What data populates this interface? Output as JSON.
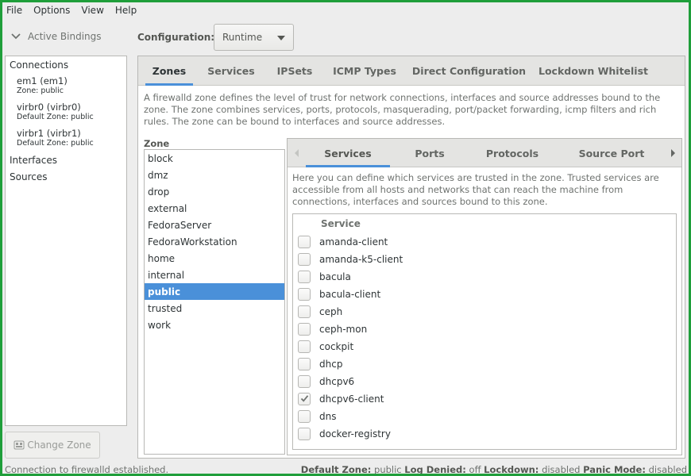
{
  "menubar": {
    "items": [
      "File",
      "Options",
      "View",
      "Help"
    ]
  },
  "sidebar": {
    "active_bindings_label": "Active Bindings",
    "connections_heading": "Connections",
    "connections": [
      {
        "name": "em1 (em1)",
        "zone": "Zone: public"
      },
      {
        "name": "virbr0 (virbr0)",
        "zone": "Default Zone: public"
      },
      {
        "name": "virbr1 (virbr1)",
        "zone": "Default Zone: public"
      }
    ],
    "interfaces_heading": "Interfaces",
    "sources_heading": "Sources",
    "change_zone_label": "Change Zone"
  },
  "configuration": {
    "label": "Configuration:",
    "value": "Runtime"
  },
  "main_tabs": [
    "Zones",
    "Services",
    "IPSets",
    "ICMP Types",
    "Direct Configuration",
    "Lockdown Whitelist"
  ],
  "active_main_tab": "Zones",
  "zone_description": "A firewalld zone defines the level of trust for network connections, interfaces and source addresses bound to the zone. The zone combines services, ports, protocols, masquerading, port/packet forwarding, icmp filters and rich rules. The zone can be bound to interfaces and source addresses.",
  "zone_label": "Zone",
  "zones": [
    "block",
    "dmz",
    "drop",
    "external",
    "FedoraServer",
    "FedoraWorkstation",
    "home",
    "internal",
    "public",
    "trusted",
    "work"
  ],
  "selected_zone": "public",
  "inner_tabs": [
    "Services",
    "Ports",
    "Protocols",
    "Source Port"
  ],
  "active_inner_tab": "Services",
  "services_description": "Here you can define which services are trusted in the zone. Trusted services are accessible from all hosts and networks that can reach the machine from connections, interfaces and sources bound to this zone.",
  "service_column_header": "Service",
  "services": [
    {
      "name": "amanda-client",
      "checked": false
    },
    {
      "name": "amanda-k5-client",
      "checked": false
    },
    {
      "name": "bacula",
      "checked": false
    },
    {
      "name": "bacula-client",
      "checked": false
    },
    {
      "name": "ceph",
      "checked": false
    },
    {
      "name": "ceph-mon",
      "checked": false
    },
    {
      "name": "cockpit",
      "checked": false
    },
    {
      "name": "dhcp",
      "checked": false
    },
    {
      "name": "dhcpv6",
      "checked": false
    },
    {
      "name": "dhcpv6-client",
      "checked": true
    },
    {
      "name": "dns",
      "checked": false
    },
    {
      "name": "docker-registry",
      "checked": false
    }
  ],
  "statusbar": {
    "message": "Connection to firewalld established.",
    "default_zone_label": "Default Zone:",
    "default_zone_value": "public",
    "log_denied_label": "Log Denied:",
    "log_denied_value": "off",
    "lockdown_label": "Lockdown:",
    "lockdown_value": "disabled",
    "panic_mode_label": "Panic Mode:",
    "panic_mode_value": "disabled"
  },
  "colors": {
    "accent": "#4a90d9",
    "window_border": "#1f9e3a",
    "background": "#ededed"
  }
}
